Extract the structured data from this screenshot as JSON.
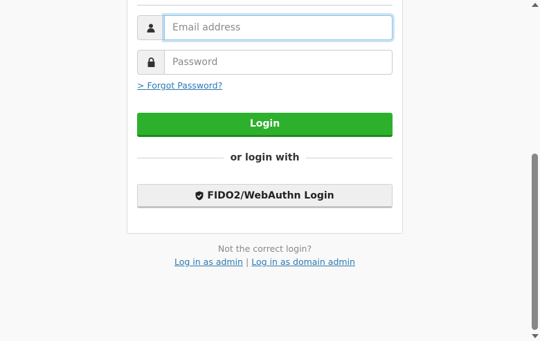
{
  "login_form": {
    "email_placeholder": "Email address",
    "password_placeholder": "Password",
    "forgot_password": "> Forgot Password?",
    "login_button": "Login",
    "divider_text": "or login with",
    "fido_button": "FIDO2/WebAuthn Login"
  },
  "footer": {
    "not_correct": "Not the correct login?",
    "admin_link": "Log in as admin",
    "separator": "|",
    "domain_admin_link": "Log in as domain admin"
  },
  "icons": {
    "email_field": "user-icon",
    "password_field": "lock-icon",
    "fido_button": "shield-check-icon"
  },
  "colors": {
    "login_button": "#2db12d",
    "link": "#2a7ab0",
    "focus_ring": "#66afe9"
  }
}
